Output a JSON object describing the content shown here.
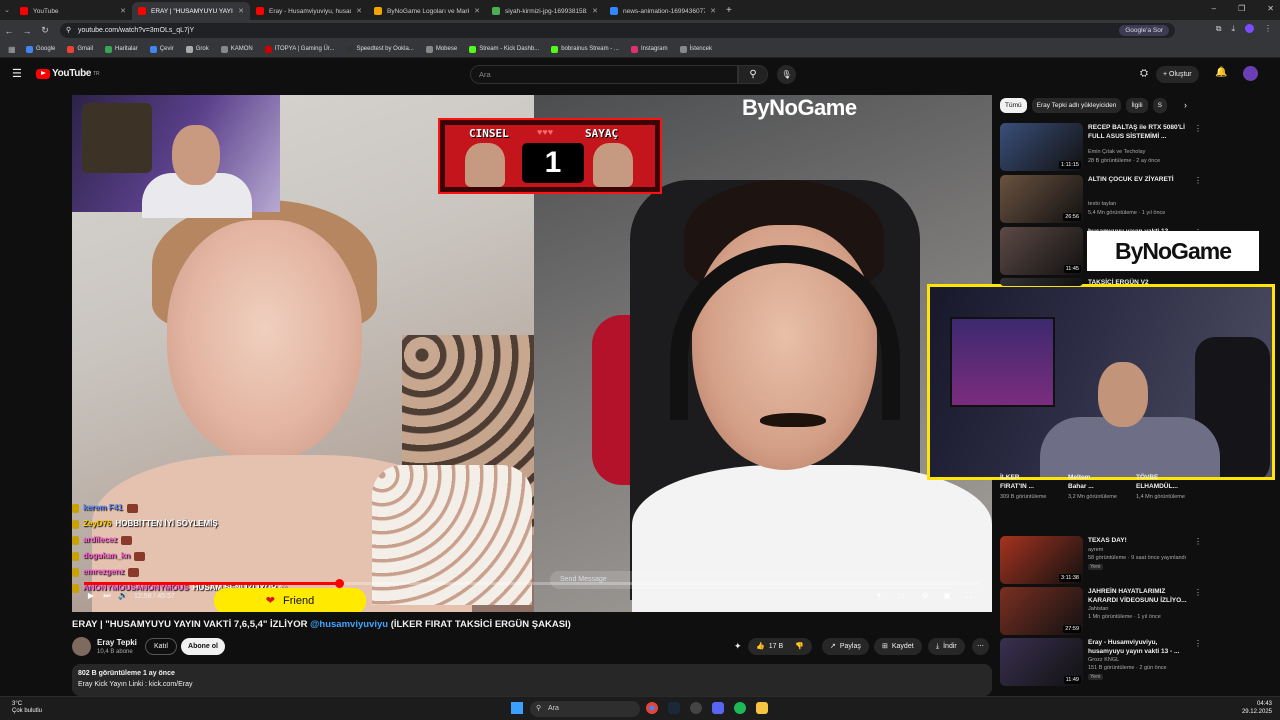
{
  "browser": {
    "tabs": [
      {
        "label": "YouTube",
        "color": "#ff0000",
        "active": false
      },
      {
        "label": "ERAY | \"HUSAMYUYU YAYIN VA",
        "color": "#ff0000",
        "active": true
      },
      {
        "label": "Eray - Husamviyuviyu, husamyu",
        "color": "#ff0000",
        "active": false
      },
      {
        "label": "ByNoGame Logoları ve Marka",
        "color": "#f4a300",
        "active": false
      },
      {
        "label": "siyah-kirmizi-jpg-1699381582",
        "color": "#4caf50",
        "active": false
      },
      {
        "label": "news-animation-16994360774",
        "color": "#2f88ff",
        "active": false
      }
    ],
    "url": "youtube.com/watch?v=3mOLs_qL7jY",
    "google_sor": "Google'a Sor",
    "bookmarks": [
      "Google",
      "Gmail",
      "Haritalar",
      "Çevir",
      "Grok",
      "KAMON",
      "ITOPYA | Gaming Ür...",
      "Speedtest by Ookla...",
      "Mobese",
      "Stream - Kick Dashb...",
      "bobrainus Stream - ...",
      "Instagram",
      "İstencek"
    ]
  },
  "youtube": {
    "logo": "YouTube",
    "logo_sup": "TR",
    "search_placeholder": "Ara",
    "create_label": "Oluştur"
  },
  "video": {
    "sayac_left": "CINSEL",
    "sayac_right": "SAYAÇ",
    "sayac_value": "1",
    "brand": "ByNoGame",
    "chat": [
      {
        "user": "kerem F41",
        "msg": "",
        "color": "#5b8cff"
      },
      {
        "user": "ZeyD76",
        "msg": "HOBBİTTEN İYİ SÖYLEMİŞ",
        "color": "#ffcc00"
      },
      {
        "user": "ardilecez",
        "msg": "",
        "color": "#ff5fd2"
      },
      {
        "user": "dogukan_kn",
        "msg": "",
        "color": "#ff5fd2"
      },
      {
        "user": "emrezgenz",
        "msg": "",
        "color": "#ff5fd2"
      },
      {
        "user": "ANONYMOUSANONYMOUS",
        "msg": "HUSAM SENİ İZLİYOR @",
        "color": "#ff5fd2"
      }
    ],
    "friend": "Friend",
    "send_message": "Send Message",
    "time": "12:58 / 45:57",
    "progress_fraction": 0.285
  },
  "details": {
    "title_main": "ERAY | \"HUSAMYUYU YAYIN VAKTİ 7,6,5,4\" İZLİYOR ",
    "title_mention": "@husamviyuviyu",
    "title_end": " (İLKER FIRAT TAKSİCİ ERGÜN ŞAKASI)",
    "channel": "Eray Tepki",
    "subs": "10,4 B abone",
    "katil": "Katıl",
    "abone": "Abone ol",
    "likes": "17 B",
    "share": "Paylaş",
    "save": "Kaydet",
    "download": "İndir",
    "views_line": "802 B görüntüleme  1 ay önce",
    "desc_line": "Eray Kick Yayın Linki : kick.com/Eray"
  },
  "sidebar": {
    "chips": [
      "Tümü",
      "Eray Tepki adlı yükleyiciden",
      "İlgili",
      "S"
    ],
    "videos": [
      {
        "title": "RECEP BALTAŞ ile RTX 5080'Lİ FULL ASUS SİSTEMİMİ ...",
        "channel": "Emin Çıtak ve Techolay",
        "meta": "28 B görüntüleme · 2 ay önce",
        "dur": "1:11:15",
        "color": "#3b4f7a"
      },
      {
        "title": "ALTIN ÇOCUK EV ZİYARETİ",
        "channel": "testo taylan",
        "meta": "5,4 Mn görüntüleme · 1 yıl önce",
        "dur": "26:56",
        "color": "#6b5240"
      },
      {
        "title": "husamyuyu yayın vakti 13",
        "channel": "",
        "meta": "",
        "dur": "11:45",
        "color": "#5d4a46"
      },
      {
        "title": "TAKSİCİ ERGÜN V2",
        "channel": "",
        "meta": "",
        "dur": "",
        "color": "#333"
      }
    ],
    "shorts": [
      {
        "title": "FIRAT'IN ...",
        "pre": "İLKER",
        "views": "309 B görüntüleme"
      },
      {
        "title": "Bahar ...",
        "pre": "Meltem",
        "views": "3,2 Mn görüntüleme"
      },
      {
        "title": "ELHAMDÜL...",
        "pre": "TÖVBE",
        "views": "1,4 Mn görüntüleme"
      }
    ],
    "videos2": [
      {
        "title": "TEXAS DAY!",
        "channel": "ayrem",
        "meta": "58 görüntüleme · 9 saat önce yayınlandı",
        "badge": "Yeni",
        "dur": "3:11:38",
        "color": "#a5331f"
      },
      {
        "title": "JAHREİN HAYATLARIMIZ KARARDI VİDEOSUNU İZLİYO...",
        "channel": "Jahistan",
        "meta": "1 Mn görüntüleme · 1 yıl önce",
        "badge": "",
        "dur": "27:59",
        "color": "#7a2f22"
      },
      {
        "title": "Eray - Husamviyuviyu, husamyuyu yayın vakti 13 - ...",
        "channel": "Grozz KNGL",
        "meta": "151 B görüntüleme · 2 gün önce",
        "badge": "Yeni",
        "dur": "11:49",
        "color": "#3a3050"
      }
    ],
    "brand_card": "ByNoGame"
  },
  "taskbar": {
    "temp": "3°C",
    "weather": "Çok bulutlu",
    "search": "Ara",
    "time": "04:43",
    "date": "29.12.2025"
  }
}
